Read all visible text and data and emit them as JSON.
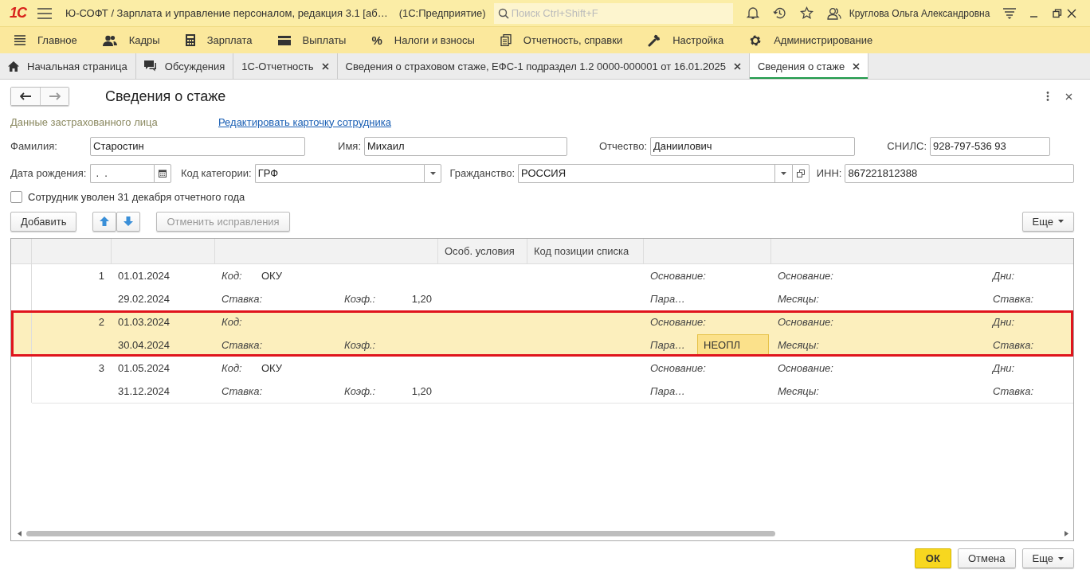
{
  "app_bar": {
    "logo": "1С",
    "title": "Ю-СОФТ / Зарплата и управление персоналом, редакция 3.1 [аб…",
    "platform": "(1С:Предприятие)",
    "search": {
      "placeholder": "Поиск Ctrl+Shift+F"
    },
    "user": "Круглова Ольга Александровна"
  },
  "sections": [
    {
      "label": "Главное"
    },
    {
      "label": "Кадры"
    },
    {
      "label": "Зарплата"
    },
    {
      "label": "Выплаты"
    },
    {
      "label": "Налоги и взносы",
      "glyph": "%"
    },
    {
      "label": "Отчетность, справки"
    },
    {
      "label": "Настройка"
    },
    {
      "label": "Администрирование"
    }
  ],
  "tabs": [
    {
      "label": "Начальная страница",
      "selected": false,
      "closable": false
    },
    {
      "label": "Обсуждения",
      "selected": false,
      "closable": false
    },
    {
      "label": "1С-Отчетность",
      "selected": false,
      "closable": true
    },
    {
      "label": "Сведения о страховом стаже, ЕФС-1 подраздел 1.2 0000-000001 от 16.01.2025",
      "selected": false,
      "closable": true
    },
    {
      "label": "Сведения о стаже",
      "selected": true,
      "closable": true
    }
  ],
  "form": {
    "title": "Сведения о стаже",
    "section_label": "Данные застрахованного лица",
    "edit_link": "Редактировать карточку сотрудника",
    "surname": {
      "label": "Фамилия:",
      "value": "Старостин"
    },
    "name": {
      "label": "Имя:",
      "value": "Михаил"
    },
    "patronymic": {
      "label": "Отчество:",
      "value": "Даниилович"
    },
    "snils": {
      "label": "СНИЛС:",
      "value": "928-797-536 93"
    },
    "birth_date": {
      "label": "Дата рождения:",
      "value": " .  ."
    },
    "category": {
      "label": "Код категории:",
      "value": "ГРФ"
    },
    "citizenship": {
      "label": "Гражданство:",
      "value": "РОССИЯ"
    },
    "inn": {
      "label": "ИНН:",
      "value": "867221812388"
    },
    "dismissed": {
      "label": "Сотрудник уволен 31 декабря отчетного года",
      "checked": false
    },
    "toolbar": {
      "add": "Добавить",
      "cancel_fixes": {
        "label": "Отменить исправления",
        "disabled": true
      },
      "more": "Еще"
    },
    "table": {
      "columns": [
        "Особ. условия",
        "Код позиции списка"
      ],
      "rows": [
        {
          "num": "1",
          "start": "01.01.2024",
          "end": "29.02.2024",
          "selected": false,
          "kod_label": "Код:",
          "kod": "ОКУ",
          "stavka_label": "Ставка:",
          "koef_label": "Коэф.:",
          "koef": "1,20",
          "osn_label": "Основание:",
          "param_label": "Пара…",
          "param": null,
          "osn2_label": "Основание:",
          "months_label": "Месяцы:",
          "days_label": "Дни:",
          "rate_label": "Ставка:"
        },
        {
          "num": "2",
          "start": "01.03.2024",
          "end": "30.04.2024",
          "selected": true,
          "kod_label": "Код:",
          "kod": null,
          "stavka_label": "Ставка:",
          "koef_label": "Коэф.:",
          "koef": null,
          "osn_label": "Основание:",
          "param_label": "Пара…",
          "param": "НЕОПЛ",
          "param_focused": true,
          "osn2_label": "Основание:",
          "months_label": "Месяцы:",
          "days_label": "Дни:",
          "rate_label": "Ставка:"
        },
        {
          "num": "3",
          "start": "01.05.2024",
          "end": "31.12.2024",
          "selected": false,
          "kod_label": "Код:",
          "kod": "ОКУ",
          "stavka_label": "Ставка:",
          "koef_label": "Коэф.:",
          "koef": "1,20",
          "osn_label": "Основание:",
          "param_label": "Пара…",
          "param": null,
          "osn2_label": "Основание:",
          "months_label": "Месяцы:",
          "days_label": "Дни:",
          "rate_label": "Ставка:"
        }
      ]
    },
    "buttons": {
      "ok": "ОК",
      "cancel": "Отмена",
      "more": "Еще"
    }
  }
}
